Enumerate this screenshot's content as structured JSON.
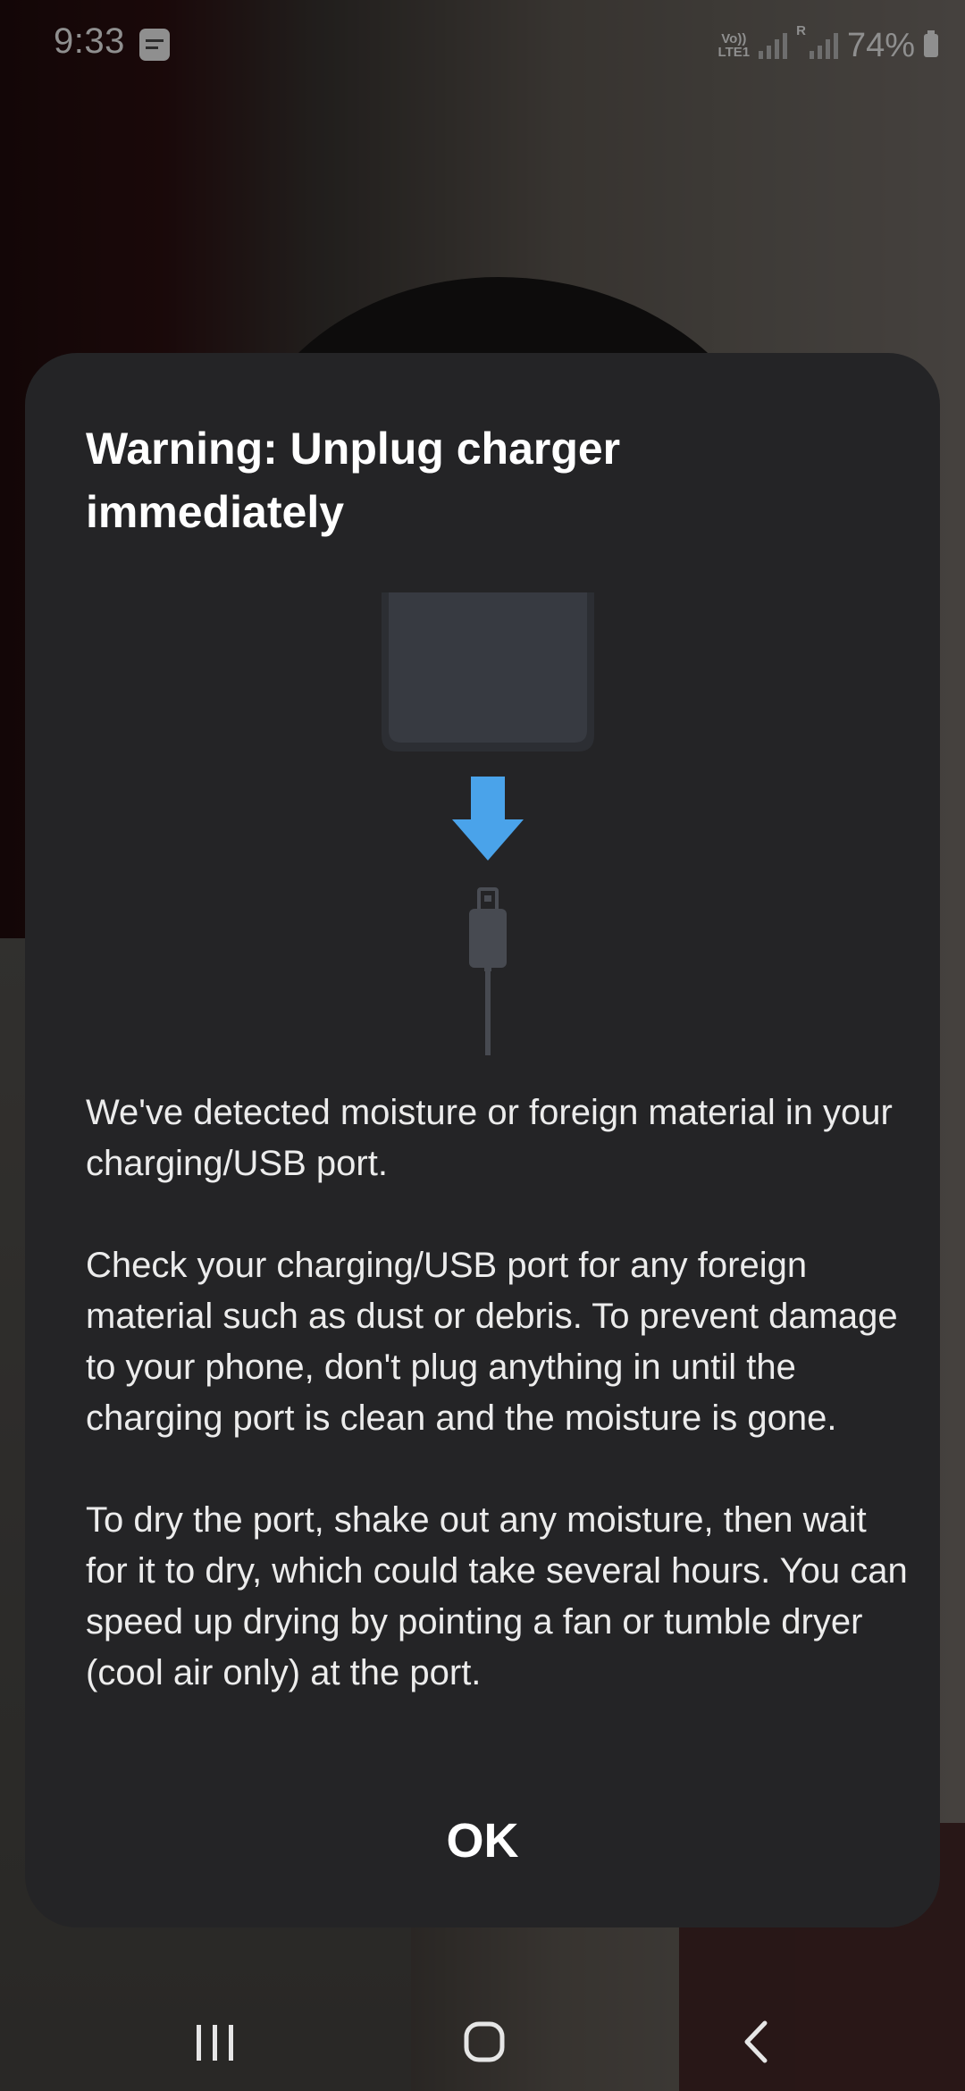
{
  "status_bar": {
    "time": "9:33",
    "volte_label": "Vo))\nLTE1",
    "signal2_label": "R",
    "battery_percent": "74%",
    "icons": [
      "notification-icon",
      "volte-icon",
      "signal-icon",
      "signal-r-icon",
      "battery-icon"
    ]
  },
  "dialog": {
    "title": "Warning: Unplug charger immediately",
    "illustration_icon": "unplug-charger-illustration",
    "arrow_color": "#4aa3ea",
    "paragraphs": [
      "We've detected moisture or foreign material in your charging/USB port.",
      "Check your charging/USB port for any foreign material such as dust or debris. To prevent damage to your phone, don't plug anything in until the charging port is clean and the moisture is gone.",
      "To dry the port, shake out any moisture, then wait for it to dry, which could take several hours. You can speed up drying by pointing a fan or tumble dryer (cool air only) at the port."
    ],
    "ok_label": "OK"
  },
  "nav_bar": {
    "recents_icon": "recents-icon",
    "home_icon": "home-icon",
    "back_icon": "back-icon"
  },
  "colors": {
    "dialog_background": "#242426",
    "text_primary": "#ffffff",
    "accent_arrow": "#4aa3ea"
  }
}
